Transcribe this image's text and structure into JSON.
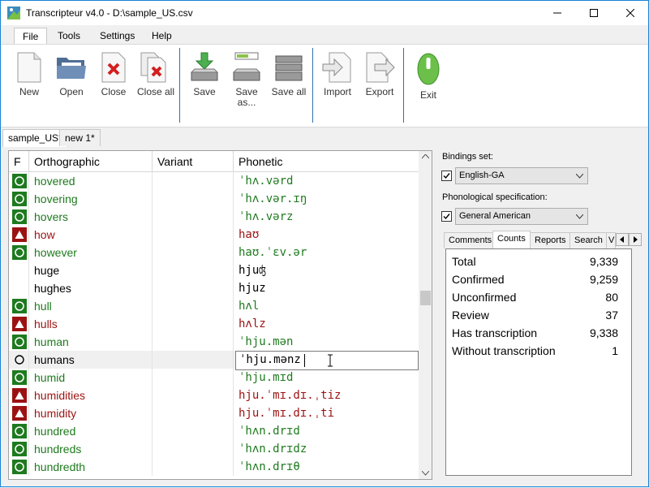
{
  "window": {
    "title": "Transcripteur v4.0 - D:\\sample_US.csv"
  },
  "menu": [
    "File",
    "Tools",
    "Settings",
    "Help"
  ],
  "toolbar": {
    "new": "New",
    "open": "Open",
    "close": "Close",
    "close_all": "Close all",
    "save": "Save",
    "save_as": "Save as...",
    "save_all": "Save all",
    "import": "Import",
    "export": "Export",
    "exit": "Exit"
  },
  "doc_tabs": [
    "sample_US*",
    "new 1*"
  ],
  "grid": {
    "headers": [
      "F",
      "Orthographic",
      "Variant",
      "Phonetic"
    ],
    "rows": [
      {
        "flag": "confirmed",
        "word": "hovered",
        "variant": "",
        "phonetic": "ˈhʌ.vərd"
      },
      {
        "flag": "confirmed",
        "word": "hovering",
        "variant": "",
        "phonetic": "ˈhʌ.vər.ɪŋ"
      },
      {
        "flag": "confirmed",
        "word": "hovers",
        "variant": "",
        "phonetic": "ˈhʌ.vərz"
      },
      {
        "flag": "review",
        "word": "how",
        "variant": "",
        "phonetic": "haʊ"
      },
      {
        "flag": "confirmed",
        "word": "however",
        "variant": "",
        "phonetic": "haʊ.ˈɛv.ər"
      },
      {
        "flag": "none",
        "word": "huge",
        "variant": "",
        "phonetic": "hjuʤ"
      },
      {
        "flag": "none",
        "word": "hughes",
        "variant": "",
        "phonetic": "hjuz"
      },
      {
        "flag": "confirmed",
        "word": "hull",
        "variant": "",
        "phonetic": "hʌl"
      },
      {
        "flag": "review",
        "word": "hulls",
        "variant": "",
        "phonetic": "hʌlz"
      },
      {
        "flag": "confirmed",
        "word": "human",
        "variant": "",
        "phonetic": "ˈhju.mən"
      },
      {
        "flag": "editing",
        "word": "humans",
        "variant": "",
        "phonetic": "ˈhju.mənz"
      },
      {
        "flag": "confirmed",
        "word": "humid",
        "variant": "",
        "phonetic": "ˈhju.mɪd"
      },
      {
        "flag": "review",
        "word": "humidities",
        "variant": "",
        "phonetic": "hju.ˈmɪ.dɪ.ˌtiz"
      },
      {
        "flag": "review",
        "word": "humidity",
        "variant": "",
        "phonetic": "hju.ˈmɪ.dɪ.ˌti"
      },
      {
        "flag": "confirmed",
        "word": "hundred",
        "variant": "",
        "phonetic": "ˈhʌn.drɪd"
      },
      {
        "flag": "confirmed",
        "word": "hundreds",
        "variant": "",
        "phonetic": "ˈhʌn.drɪdz"
      },
      {
        "flag": "confirmed",
        "word": "hundredth",
        "variant": "",
        "phonetic": "ˈhʌn.drɪθ"
      }
    ]
  },
  "right_panel": {
    "bindings_label": "Bindings set:",
    "bindings_value": "English-GA",
    "phono_label": "Phonological specification:",
    "phono_value": "General American",
    "tabs": [
      "Comments",
      "Counts",
      "Reports",
      "Search",
      "V"
    ],
    "counts": [
      {
        "label": "Total",
        "value": "9,339"
      },
      {
        "label": "Confirmed",
        "value": "9,259"
      },
      {
        "label": "Unconfirmed",
        "value": "80"
      },
      {
        "label": "Review",
        "value": "37"
      },
      {
        "label": "Has transcription",
        "value": "9,338"
      },
      {
        "label": "Without transcription",
        "value": "1"
      }
    ]
  },
  "colors": {
    "green": "#1e7a1e",
    "red": "#9b1212",
    "accent": "#1883d7"
  }
}
